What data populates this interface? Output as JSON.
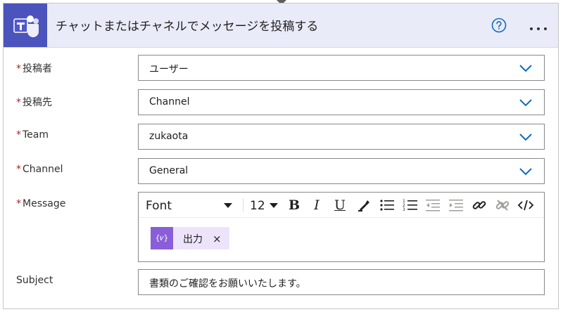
{
  "header": {
    "title": "チャットまたはチャネルでメッセージを投稿する",
    "app_icon": "teams-icon",
    "help_icon": "help-circle-icon",
    "more_icon": "more-horizontal-icon"
  },
  "fields": [
    {
      "label": "投稿者",
      "required": "*",
      "value": "ユーザー"
    },
    {
      "label": "投稿先",
      "required": "*",
      "value": "Channel"
    },
    {
      "label": "Team",
      "required": "*",
      "value": "zukaota"
    },
    {
      "label": "Channel",
      "required": "*",
      "value": "General"
    }
  ],
  "message": {
    "label": "Message",
    "required": "*",
    "toolbar": {
      "font": "Font",
      "size": "12",
      "bold": "B",
      "italic": "I",
      "underline": "U"
    },
    "token": {
      "icon_text": "{𝑣}",
      "label": "出力",
      "close": "×"
    }
  },
  "subject": {
    "label": "Subject",
    "value": "書類のご確認をお願いいたします。"
  },
  "colors": {
    "header_bg": "#e9ebf9",
    "app_icon_bg": "#4b53bc",
    "accent": "#0f6cbd",
    "required": "#a4262c",
    "token_bg": "#ede4fb",
    "token_icon_bg": "#8a5ed8"
  }
}
